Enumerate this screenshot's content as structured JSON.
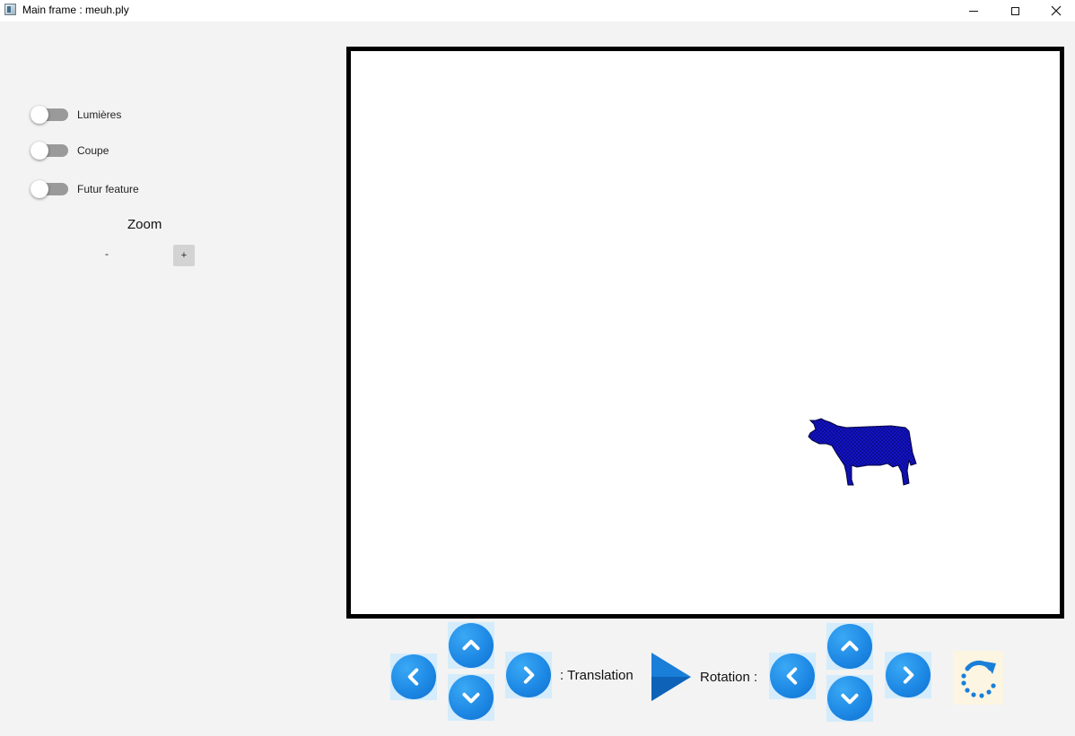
{
  "window": {
    "title": "Main frame : meuh.ply"
  },
  "sidebar": {
    "toggles": [
      {
        "label": "Lumières",
        "on": false
      },
      {
        "label": "Coupe",
        "on": false
      },
      {
        "label": "Futur feature",
        "on": false
      }
    ],
    "zoom": {
      "title": "Zoom",
      "minus_label": "-",
      "plus_label": "+"
    }
  },
  "viewport": {
    "model_icon": "cow-mesh",
    "model_color": "#1010c8"
  },
  "controls": {
    "translation_label": ": Translation",
    "rotation_label": "Rotation :",
    "icons": {
      "left": "chevron-left-icon",
      "right": "chevron-right-icon",
      "up": "chevron-up-icon",
      "down": "chevron-down-icon",
      "play": "play-icon",
      "reset": "rotate-reset-icon"
    },
    "accent": "#1c86e3"
  }
}
